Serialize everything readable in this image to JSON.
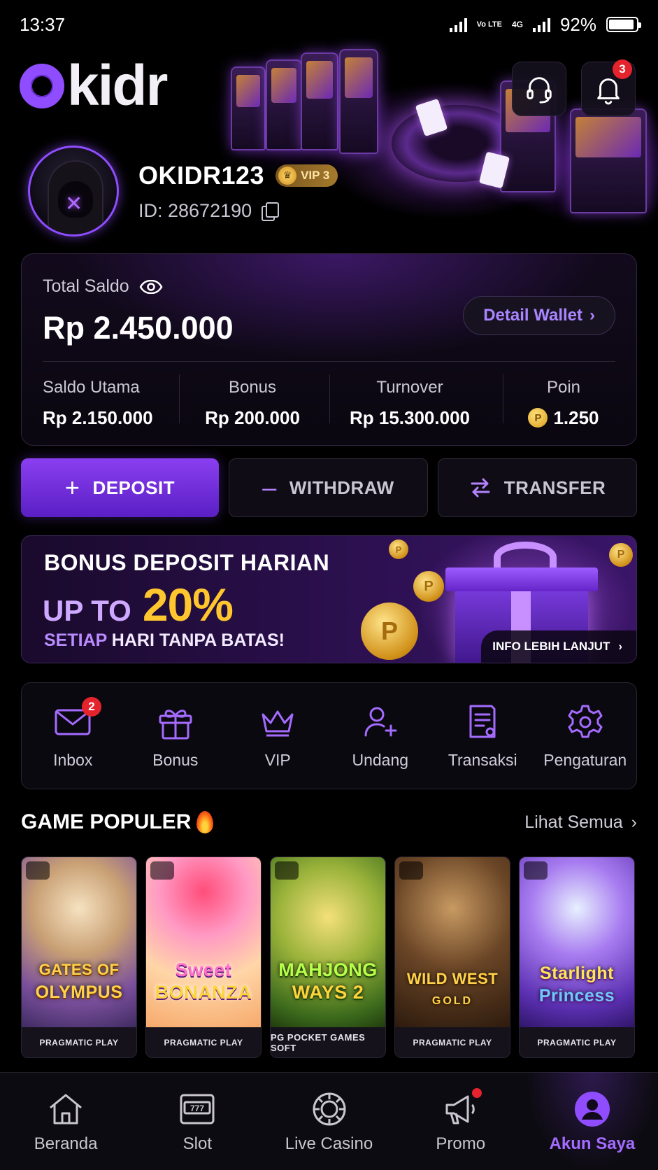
{
  "status": {
    "time": "13:37",
    "volte": "Vo LTE",
    "net": "4G",
    "battery": "92%",
    "battery_level": 0.92
  },
  "app": {
    "logo_text": "kidr",
    "notifications_count": "3"
  },
  "profile": {
    "username": "OKIDR123",
    "vip": "VIP 3",
    "id": "ID: 28672190"
  },
  "balance": {
    "label": "Total Saldo",
    "amount": "Rp 2.450.000",
    "detail_button": "Detail Wallet",
    "stats": [
      {
        "label": "Saldo Utama",
        "value": "Rp 2.150.000"
      },
      {
        "label": "Bonus",
        "value": "Rp 200.000"
      },
      {
        "label": "Turnover",
        "value": "Rp 15.300.000"
      },
      {
        "label": "Poin",
        "value": "1.250"
      }
    ]
  },
  "actions": {
    "deposit": "DEPOSIT",
    "withdraw": "WITHDRAW",
    "transfer": "TRANSFER"
  },
  "promo": {
    "line1": "BONUS DEPOSIT HARIAN",
    "upto": "UP TO",
    "percent": "20%",
    "line3_a": "SETIAP",
    "line3_b": " HARI TANPA BATAS!",
    "button": "INFO LEBIH LANJUT"
  },
  "quick_menu": [
    {
      "label": "Inbox",
      "icon": "mail-icon",
      "badge": "2"
    },
    {
      "label": "Bonus",
      "icon": "gift-icon"
    },
    {
      "label": "VIP",
      "icon": "crown-icon"
    },
    {
      "label": "Undang",
      "icon": "user-plus-icon"
    },
    {
      "label": "Transaksi",
      "icon": "receipt-icon"
    },
    {
      "label": "Pengaturan",
      "icon": "gear-icon"
    }
  ],
  "games_section": {
    "title": "GAME POPULER",
    "see_all": "Lihat Semua",
    "games": [
      {
        "title_a": "GATES OF",
        "title_b": "OLYMPUS",
        "provider": "PRAGMATIC PLAY"
      },
      {
        "title_a": "Sweet",
        "title_b": "BONANZA",
        "provider": "PRAGMATIC PLAY"
      },
      {
        "title_a": "MAHJONG",
        "title_b": "WAYS 2",
        "provider": "PG POCKET GAMES SOFT"
      },
      {
        "title_a": "WILD WEST",
        "title_b": "GOLD",
        "provider": "PRAGMATIC PLAY"
      },
      {
        "title_a": "Starlight",
        "title_b": "Princess",
        "provider": "PRAGMATIC PLAY"
      }
    ]
  },
  "bottom_nav": [
    {
      "label": "Beranda",
      "icon": "home-icon"
    },
    {
      "label": "Slot",
      "icon": "slot-machine-icon"
    },
    {
      "label": "Live Casino",
      "icon": "chip-icon"
    },
    {
      "label": "Promo",
      "icon": "megaphone-icon"
    },
    {
      "label": "Akun Saya",
      "icon": "user-icon",
      "active": true
    }
  ],
  "colors": {
    "accent": "#8f4dff",
    "gold": "#ffc62e",
    "badge": "#e5232c",
    "background": "#000000"
  }
}
